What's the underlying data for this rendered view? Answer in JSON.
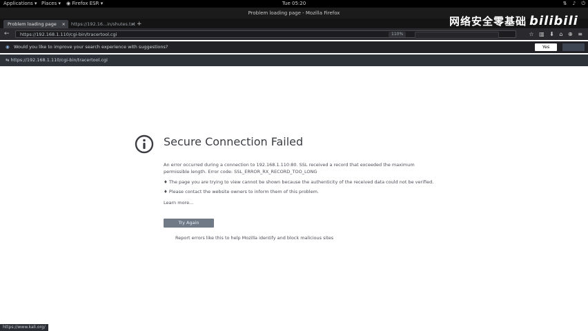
{
  "topbar": {
    "applications": "Applications",
    "places": "Places",
    "app": "Firefox ESR",
    "clock": "Tue 05:20"
  },
  "window": {
    "title": "Problem loading page - Mozilla Firefox"
  },
  "tabs": [
    {
      "label": "Problem loading page"
    },
    {
      "label": "https://192.16...in/shutes.txt"
    }
  ],
  "watermark": {
    "text": "网络安全零基础",
    "brand": "bilibili"
  },
  "navbar": {
    "url": "https://192.168.1.110/cgi-bin/tracertool.cgi",
    "zoom": "110%"
  },
  "notification": {
    "question": "Would you like to improve your search experience with suggestions?",
    "yes_label": "Yes"
  },
  "history": {
    "text": "https://192.168.1.110/cgi-bin/tracertool.cgi"
  },
  "error": {
    "title": "Secure Connection Failed",
    "description": "An error occurred during a connection to 192.168.1.110:80. SSL received a record that exceeded the maximum permissible length. Error code: SSL_ERROR_RX_RECORD_TOO_LONG",
    "bullets": [
      "The page you are trying to view cannot be shown because the authenticity of the received data could not be verified.",
      "Please contact the website owners to inform them of this problem."
    ],
    "learn_more": "Learn more...",
    "try_again": "Try Again",
    "report": "Report errors like this to help Mozilla identify and block malicious sites"
  },
  "statusbar": {
    "text": "https://www.kali.org/"
  }
}
